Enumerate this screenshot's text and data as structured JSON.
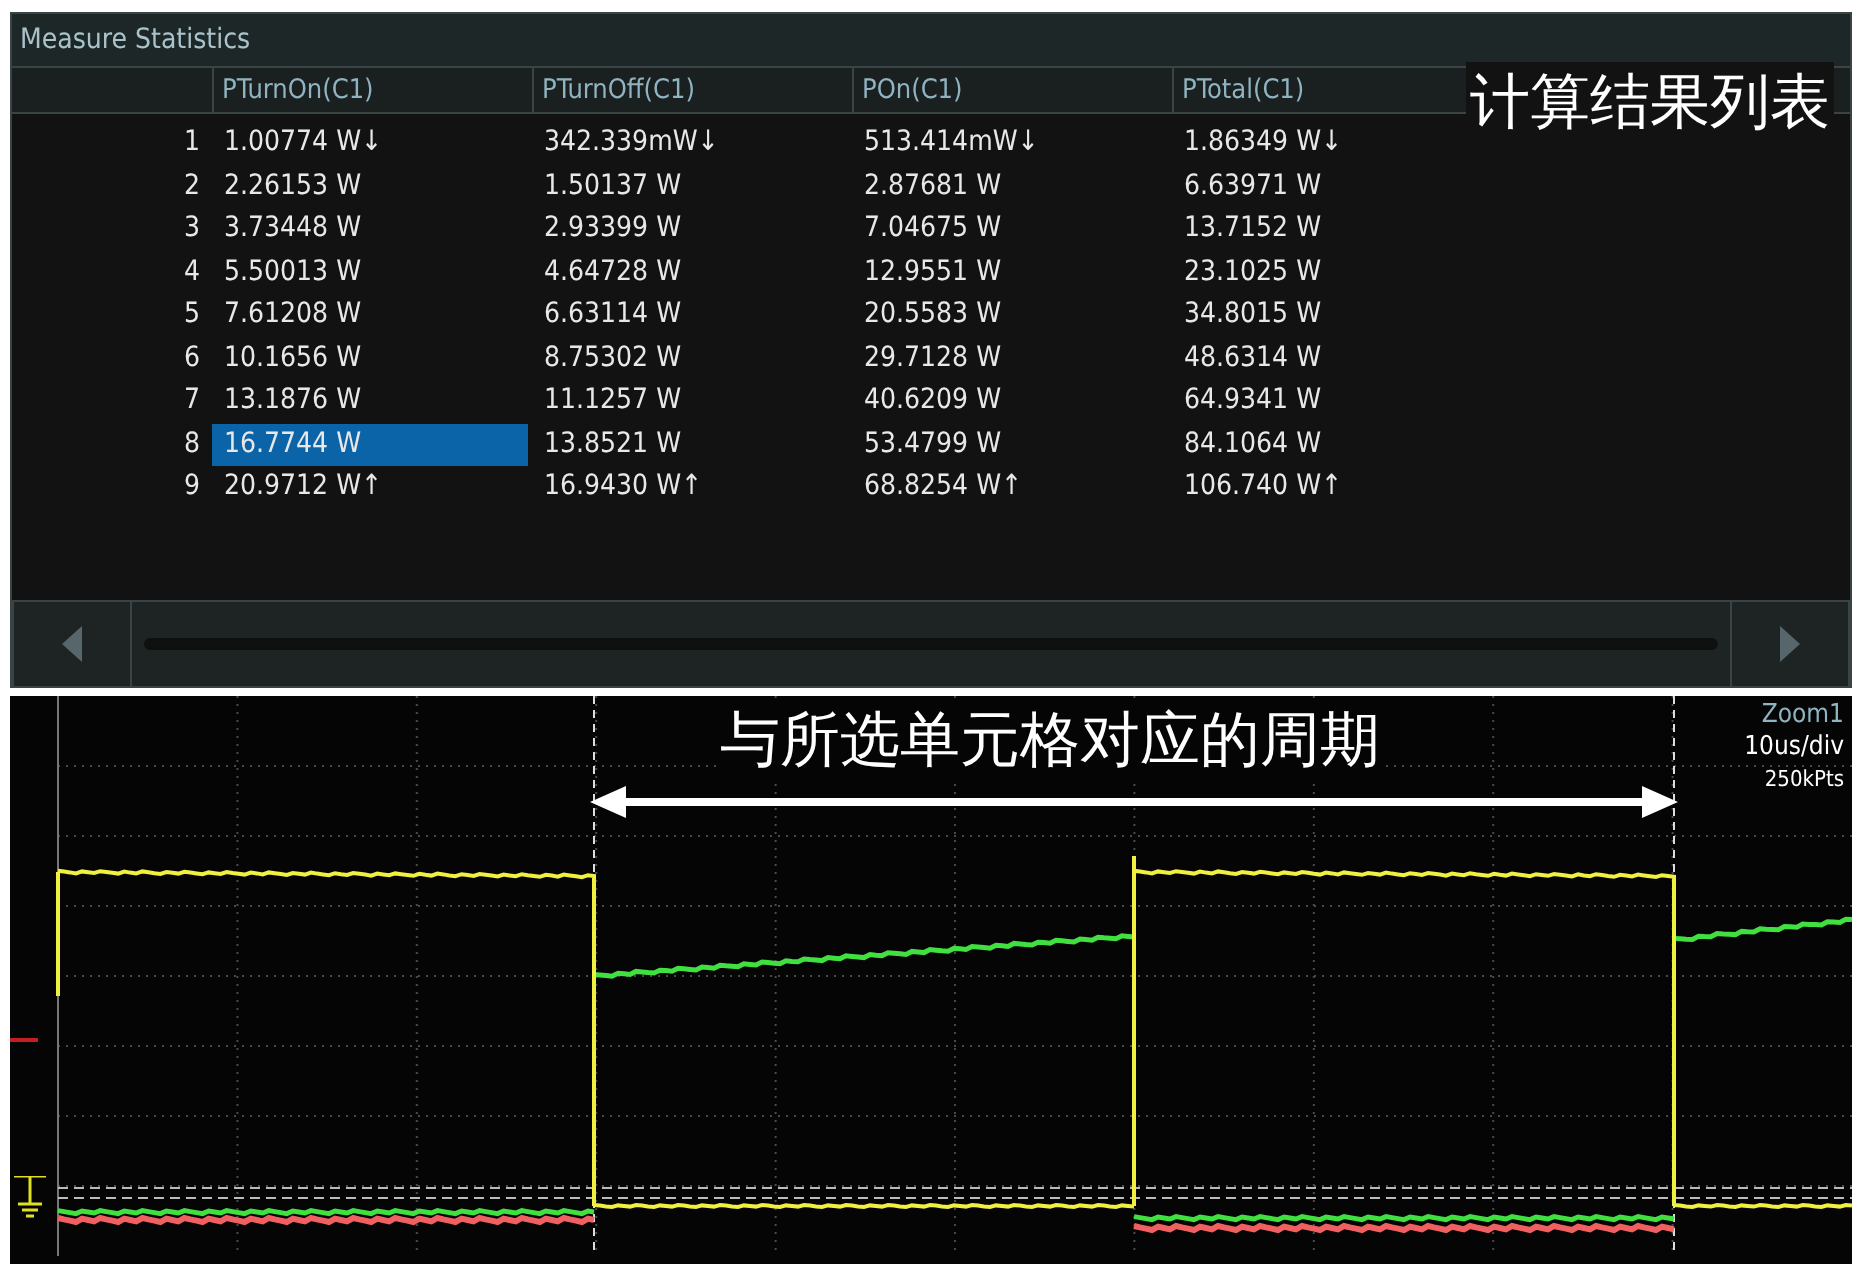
{
  "panel": {
    "title": "Measure Statistics"
  },
  "table": {
    "columns": [
      "PTurnOn(C1)",
      "PTurnOff(C1)",
      "POn(C1)",
      "PTotal(C1)"
    ],
    "rows": [
      {
        "number": "1",
        "cells": [
          {
            "text": "1.00774 W↓",
            "selected": false
          },
          {
            "text": "342.339mW↓",
            "selected": false
          },
          {
            "text": "513.414mW↓",
            "selected": false
          },
          {
            "text": "1.86349 W↓",
            "selected": false
          }
        ]
      },
      {
        "number": "2",
        "cells": [
          {
            "text": "2.26153 W",
            "selected": false
          },
          {
            "text": "1.50137 W",
            "selected": false
          },
          {
            "text": "2.87681 W",
            "selected": false
          },
          {
            "text": "6.63971 W",
            "selected": false
          }
        ]
      },
      {
        "number": "3",
        "cells": [
          {
            "text": "3.73448 W",
            "selected": false
          },
          {
            "text": "2.93399 W",
            "selected": false
          },
          {
            "text": "7.04675 W",
            "selected": false
          },
          {
            "text": "13.7152 W",
            "selected": false
          }
        ]
      },
      {
        "number": "4",
        "cells": [
          {
            "text": "5.50013 W",
            "selected": false
          },
          {
            "text": "4.64728 W",
            "selected": false
          },
          {
            "text": "12.9551 W",
            "selected": false
          },
          {
            "text": "23.1025 W",
            "selected": false
          }
        ]
      },
      {
        "number": "5",
        "cells": [
          {
            "text": "7.61208 W",
            "selected": false
          },
          {
            "text": "6.63114 W",
            "selected": false
          },
          {
            "text": "20.5583 W",
            "selected": false
          },
          {
            "text": "34.8015 W",
            "selected": false
          }
        ]
      },
      {
        "number": "6",
        "cells": [
          {
            "text": "10.1656 W",
            "selected": false
          },
          {
            "text": "8.75302 W",
            "selected": false
          },
          {
            "text": "29.7128 W",
            "selected": false
          },
          {
            "text": "48.6314 W",
            "selected": false
          }
        ]
      },
      {
        "number": "7",
        "cells": [
          {
            "text": "13.1876 W",
            "selected": false
          },
          {
            "text": "11.1257 W",
            "selected": false
          },
          {
            "text": "40.6209 W",
            "selected": false
          },
          {
            "text": "64.9341 W",
            "selected": false
          }
        ]
      },
      {
        "number": "8",
        "cells": [
          {
            "text": "16.7744 W",
            "selected": true
          },
          {
            "text": "13.8521 W",
            "selected": false
          },
          {
            "text": "53.4799 W",
            "selected": false
          },
          {
            "text": "84.1064 W",
            "selected": false
          }
        ]
      },
      {
        "number": "9",
        "cells": [
          {
            "text": "20.9712 W↑",
            "selected": false
          },
          {
            "text": "16.9430 W↑",
            "selected": false
          },
          {
            "text": "68.8254 W↑",
            "selected": false
          },
          {
            "text": "106.740 W↑",
            "selected": false
          }
        ]
      }
    ]
  },
  "table_annotation": "计算结果列表",
  "waveform": {
    "zoom_label": "Zoom1",
    "timebase": "10us/div",
    "points": "250kPts",
    "period_annotation": "与所选单元格对应的周期"
  }
}
